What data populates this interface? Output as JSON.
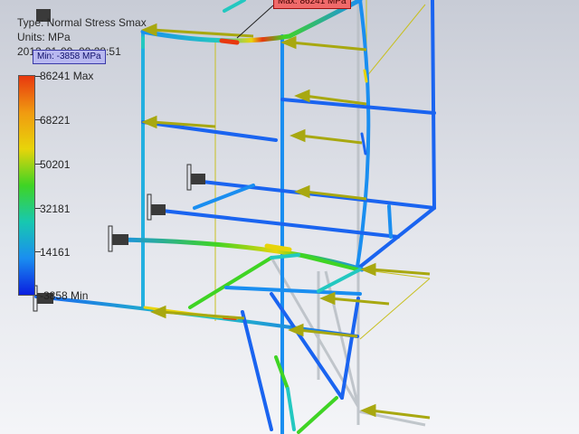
{
  "result": {
    "type_line": "Type: Normal Stress Smax",
    "units_line": "Units: MPa",
    "date_line": "2012-01-09, 09:28:51"
  },
  "callouts": {
    "min_label": "Min: -3858 MPa",
    "max_label": "Max: 86241 MPa"
  },
  "legend": {
    "levels": [
      {
        "label": "86241 Max",
        "color": "#e8380f",
        "value": 86241
      },
      {
        "label": "68221",
        "color": "#e8d40a",
        "value": 68221
      },
      {
        "label": "50201",
        "color": "#3fd424",
        "value": 50201
      },
      {
        "label": "32181",
        "color": "#17c8b0",
        "value": 32181
      },
      {
        "label": "14161",
        "color": "#1a8ef0",
        "value": 14161
      },
      {
        "label": "-3858 Min",
        "color": "#0a1ee0",
        "value": -3858
      }
    ],
    "gradient": [
      "#e8380f",
      "#f09a10",
      "#e8d40a",
      "#3fd424",
      "#17c8b0",
      "#1a8ef0",
      "#0a1ee0"
    ]
  },
  "colors": {
    "load_arrow": "#a8a810",
    "constraint": "#3a3a3a",
    "frame_low": "#1a64f0",
    "frame_mid": "#23c8c0",
    "frame_high": "#e8380f",
    "undeformed": "#b8bec4"
  }
}
